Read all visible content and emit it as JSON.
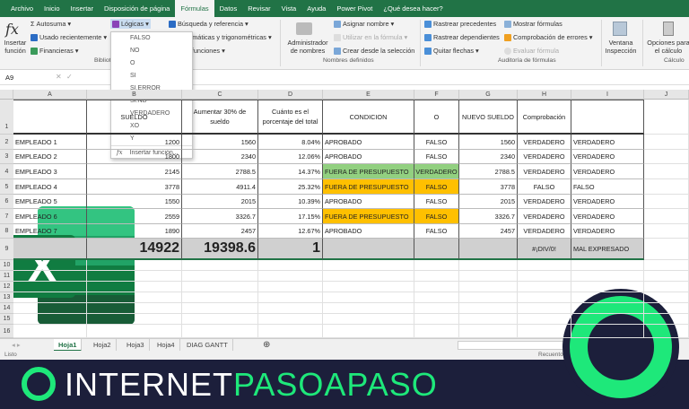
{
  "tabs": [
    "Archivo",
    "Inicio",
    "Insertar",
    "Disposición de página",
    "Fórmulas",
    "Datos",
    "Revisar",
    "Vista",
    "Ayuda",
    "Power Pivot",
    "¿Qué desea hacer?"
  ],
  "ribbon": {
    "insert_fn": "Insertar función",
    "autosum": "Autosuma",
    "recent": "Usado recientemente",
    "financial": "Financieras",
    "logical": "Lógicas",
    "lookup": "Búsqueda y referencia",
    "math": "Matemáticas y trigonométricas",
    "more": "Más funciones",
    "group_lib": "Biblioteca de funciones",
    "name_mgr": "Administrador de nombres",
    "assign_name": "Asignar nombre",
    "use_in_formula": "Utilizar en la fórmula",
    "create_from_sel": "Crear desde la selección",
    "group_names": "Nombres definidos",
    "trace_prec": "Rastrear precedentes",
    "trace_dep": "Rastrear dependientes",
    "remove_arrows": "Quitar flechas",
    "show_formulas": "Mostrar fórmulas",
    "error_check": "Comprobación de errores",
    "eval_formula": "Evaluar fórmula",
    "group_audit": "Auditoría de fórmulas",
    "watch": "Ventana Inspección",
    "calc_opts": "Opciones para el cálculo",
    "group_calc": "Cálculo"
  },
  "formula_bar": {
    "name_box": "A9",
    "value": ""
  },
  "dropdown": {
    "items": [
      "FALSO",
      "NO",
      "O",
      "SI",
      "SI.ERROR",
      "SI.ND",
      "VERDADERO",
      "XO",
      "Y"
    ],
    "insert": "Insertar función..."
  },
  "columns": [
    "A",
    "B",
    "C",
    "D",
    "E",
    "F",
    "G",
    "H",
    "I",
    "J"
  ],
  "header": [
    "",
    "SUELDO",
    "Aumentar 30% de sueldo",
    "Cuánto es el porcentaje del total",
    "CONDICION",
    "O",
    "NUEVO SUELDO",
    "Comprobación",
    ""
  ],
  "rows": [
    [
      "EMPLEADO 1",
      "1200",
      "1560",
      "8.04%",
      "APROBADO",
      "FALSO",
      "1560",
      "VERDADERO",
      "VERDADERO"
    ],
    [
      "EMPLEADO 2",
      "1800",
      "2340",
      "12.06%",
      "APROBADO",
      "FALSO",
      "2340",
      "VERDADERO",
      "VERDADERO"
    ],
    [
      "EMPLEADO 3",
      "2145",
      "2788.5",
      "14.37%",
      "FUERA DE PRESUPUESTO",
      "VERDADERO",
      "2788.5",
      "VERDADERO",
      "VERDADERO"
    ],
    [
      "EMPLEADO 4",
      "3778",
      "4911.4",
      "25.32%",
      "FUERA DE PRESUPUESTO",
      "FALSO",
      "3778",
      "FALSO",
      "FALSO"
    ],
    [
      "EMPLEADO 5",
      "1550",
      "2015",
      "10.39%",
      "APROBADO",
      "FALSO",
      "2015",
      "VERDADERO",
      "VERDADERO"
    ],
    [
      "EMPLEADO 6",
      "2559",
      "3326.7",
      "17.15%",
      "FUERA DE PRESUPUESTO",
      "FALSO",
      "3326.7",
      "VERDADERO",
      "VERDADERO"
    ],
    [
      "EMPLEADO 7",
      "1890",
      "2457",
      "12.67%",
      "APROBADO",
      "FALSO",
      "2457",
      "VERDADERO",
      "VERDADERO"
    ]
  ],
  "totals": [
    "",
    "14922",
    "19398.6",
    "1",
    "",
    "",
    "",
    "#¡DIV/0!",
    "MAL EXPRESADO"
  ],
  "row_numbers": [
    "1",
    "2",
    "3",
    "4",
    "5",
    "6",
    "7",
    "8",
    "9",
    "10",
    "11",
    "12",
    "13",
    "14",
    "15",
    "16"
  ],
  "sheets": [
    "Hoja1",
    "Hoja2",
    "Hoja3",
    "Hoja4",
    "DIAG GANTT"
  ],
  "status": {
    "left": "Listo",
    "right": "Recuento"
  },
  "banner": {
    "brand_white": "INTERNET",
    "brand_green": "PASOAPASO"
  },
  "colors": {
    "green": "#217346",
    "highlight_green": "#92d080",
    "highlight_orange": "#ffc000",
    "brand_green": "#1ee87a",
    "banner_bg": "#1c1f3b"
  }
}
